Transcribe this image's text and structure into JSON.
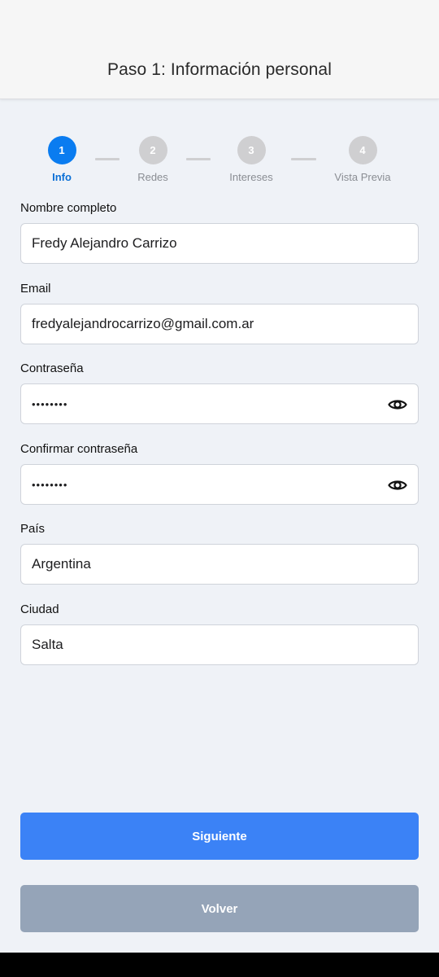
{
  "header": {
    "title": "Paso 1: Información personal"
  },
  "stepper": {
    "steps": [
      {
        "number": "1",
        "label": "Info",
        "active": true
      },
      {
        "number": "2",
        "label": "Redes",
        "active": false
      },
      {
        "number": "3",
        "label": "Intereses",
        "active": false
      },
      {
        "number": "4",
        "label": "Vista Previa",
        "active": false
      }
    ]
  },
  "form": {
    "name": {
      "label": "Nombre completo",
      "value": "Fredy Alejandro Carrizo"
    },
    "email": {
      "label": "Email",
      "value": "fredyalejandrocarrizo@gmail.com.ar"
    },
    "password": {
      "label": "Contraseña",
      "value": "••••••••"
    },
    "confirm_password": {
      "label": "Confirmar contraseña",
      "value": "••••••••"
    },
    "country": {
      "label": "País",
      "value": "Argentina"
    },
    "city": {
      "label": "Ciudad",
      "value": "Salta"
    }
  },
  "buttons": {
    "next": "Siguiente",
    "back": "Volver"
  },
  "colors": {
    "accent": "#0a7cf0",
    "primary_button": "#3b82f6",
    "secondary_button": "#95a4b8",
    "inactive_step": "#cfcfd1",
    "background": "#eff2f7"
  },
  "icons": {
    "password_toggle": "eye-icon"
  }
}
